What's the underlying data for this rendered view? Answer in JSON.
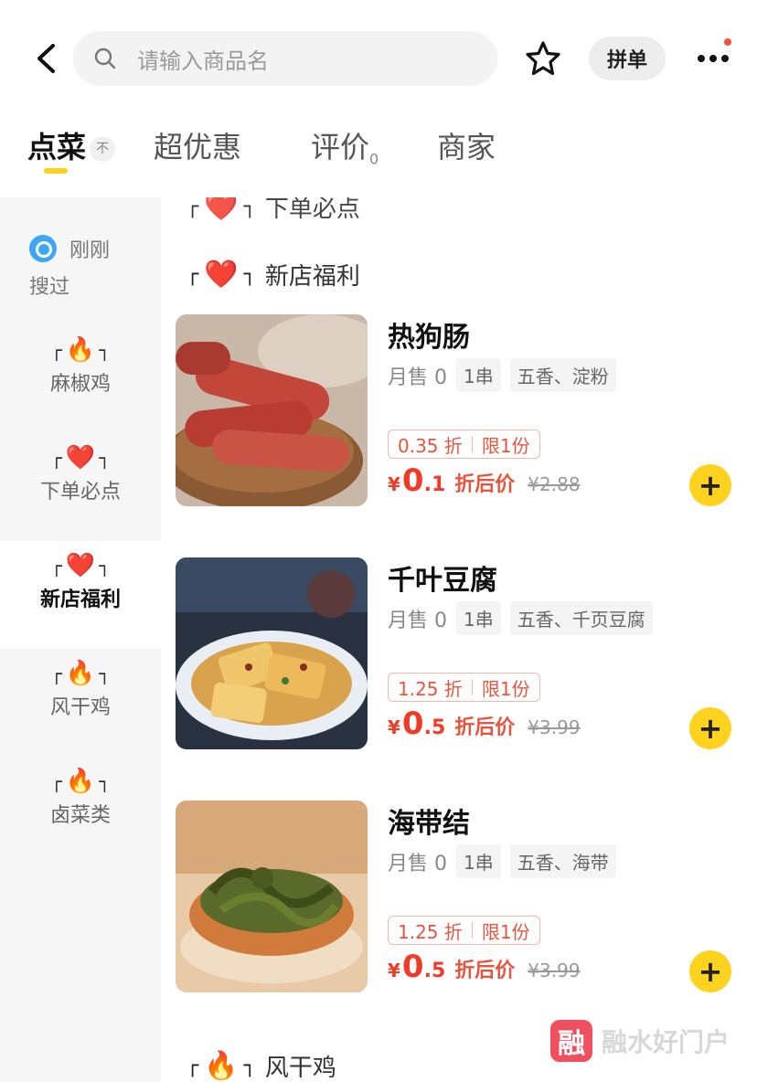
{
  "header": {
    "search_placeholder": "请输入商品名",
    "pin_label": "拼单"
  },
  "tabs": [
    {
      "label": "点菜",
      "fold": "不"
    },
    {
      "label": "超优惠"
    },
    {
      "label": "评价",
      "count": "0"
    },
    {
      "label": "商家"
    }
  ],
  "sidebar": {
    "recent_a": "刚刚",
    "recent_b": "搜过",
    "items": [
      {
        "label": "麻椒鸡",
        "emoji": "🔥"
      },
      {
        "label": "下单必点",
        "emoji": "❤️"
      },
      {
        "label": "新店福利",
        "emoji": "❤️"
      },
      {
        "label": "风干鸡",
        "emoji": "🔥"
      },
      {
        "label": "卤菜类",
        "emoji": "🔥"
      }
    ]
  },
  "main": {
    "top_cut_section": {
      "title": "下单必点",
      "emoji": "❤️"
    },
    "section": {
      "title": "新店福利",
      "emoji": "❤️"
    },
    "next_section": {
      "title": "风干鸡",
      "emoji": "🔥"
    },
    "items": [
      {
        "name": "热狗肠",
        "sold": "月售 0",
        "unit": "1串",
        "spec": "五香、淀粉",
        "discount": "0.35 折",
        "limit": "限1份",
        "yen": "¥",
        "price_int": "0",
        "price_dec": ".1",
        "after": "折后价",
        "orig": "¥2.88"
      },
      {
        "name": "千叶豆腐",
        "sold": "月售 0",
        "unit": "1串",
        "spec": "五香、千页豆腐",
        "discount": "1.25 折",
        "limit": "限1份",
        "yen": "¥",
        "price_int": "0",
        "price_dec": ".5",
        "after": "折后价",
        "orig": "¥3.99"
      },
      {
        "name": "海带结",
        "sold": "月售 0",
        "unit": "1串",
        "spec": "五香、海带",
        "discount": "1.25 折",
        "limit": "限1份",
        "yen": "¥",
        "price_int": "0",
        "price_dec": ".5",
        "after": "折后价",
        "orig": "¥3.99"
      }
    ]
  },
  "watermark": {
    "logo": "融",
    "text": "融水好门户"
  }
}
